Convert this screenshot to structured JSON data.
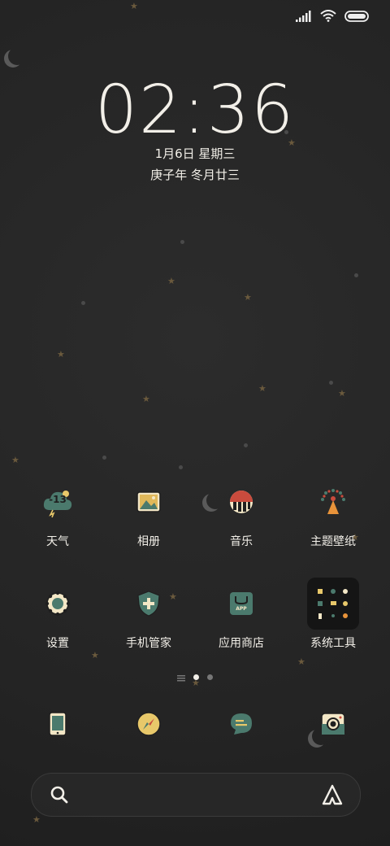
{
  "status_bar": {
    "signal_icon": "signal-bars-icon",
    "wifi_icon": "wifi-icon",
    "battery_icon": "battery-icon"
  },
  "clock": {
    "time": "02:36",
    "date": "1月6日 星期三",
    "lunar": "庚子年 冬月廿三"
  },
  "apps_row1": [
    {
      "label": "天气",
      "icon": "weather-cloud-icon",
      "badge": "-13"
    },
    {
      "label": "相册",
      "icon": "gallery-icon"
    },
    {
      "label": "音乐",
      "icon": "music-icon"
    },
    {
      "label": "主题壁纸",
      "icon": "theme-wallpaper-icon"
    }
  ],
  "apps_row2": [
    {
      "label": "设置",
      "icon": "settings-gear-icon"
    },
    {
      "label": "手机管家",
      "icon": "security-shield-icon"
    },
    {
      "label": "应用商店",
      "icon": "app-store-icon",
      "badge": "APP"
    },
    {
      "label": "系统工具",
      "icon": "system-tools-folder-icon"
    }
  ],
  "pager": {
    "icons": [
      "menu-lines-icon",
      "page-dot-active",
      "page-dot-inactive"
    ]
  },
  "dock": [
    {
      "icon": "phone-icon"
    },
    {
      "icon": "browser-compass-icon"
    },
    {
      "icon": "messages-icon"
    },
    {
      "icon": "camera-icon"
    }
  ],
  "search_bar": {
    "search_icon": "search-icon",
    "assistant_icon": "assistant-logo-icon"
  },
  "colors": {
    "background": "#262626",
    "text": "#f2efe8",
    "teal": "#4b7a6d",
    "cream": "#f3e7c6",
    "red": "#c94b3d",
    "star": "#6b5a3d"
  }
}
